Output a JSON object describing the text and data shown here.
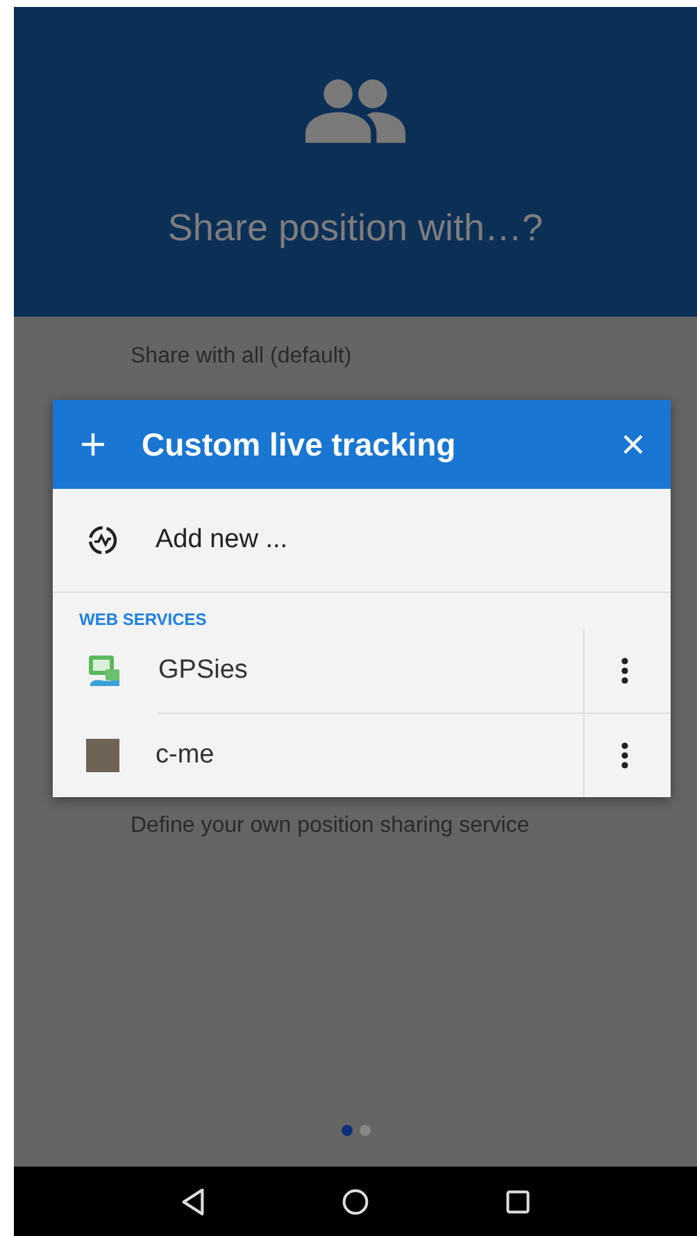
{
  "header": {
    "title": "Share position with…?"
  },
  "background_options": [
    {
      "text": "Share with all (default)"
    },
    {
      "text": "Define your own position sharing service"
    }
  ],
  "dialog": {
    "title": "Custom live tracking",
    "add_label": "Add new ...",
    "section": "WEB SERVICES",
    "services": [
      {
        "name": "GPSies",
        "kind": "logo"
      },
      {
        "name": "c-me",
        "kind": "photo"
      }
    ]
  },
  "pager": [
    {
      "selected": true
    },
    {
      "selected": false
    }
  ]
}
